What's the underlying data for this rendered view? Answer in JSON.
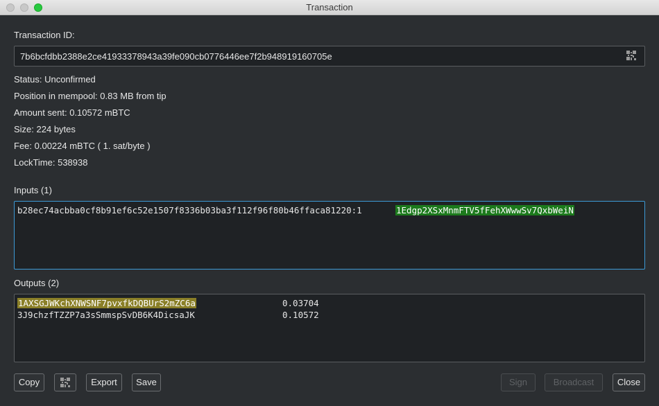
{
  "window": {
    "title": "Transaction"
  },
  "transaction_id": {
    "label": "Transaction ID:",
    "value": "7b6bcfdbb2388e2ce41933378943a39fe090cb0776446ee7f2b948919160705e"
  },
  "details": {
    "status": "Status: Unconfirmed",
    "mempool": "Position in mempool: 0.83 MB from tip",
    "amount": "Amount sent: 0.10572 mBTC",
    "size": "Size: 224 bytes",
    "fee": "Fee: 0.00224 mBTC  ( 1. sat/byte )",
    "locktime": "LockTime: 538938"
  },
  "inputs": {
    "label": "Inputs (1)",
    "items": [
      {
        "outpoint": "b28ec74acbba0cf8b91ef6c52e1507f8336b03ba3f112f96f80b46ffaca81220:1",
        "address": "1Edgp2XSxMnmFTV5fFehXWwwSv7QxbWeiN"
      }
    ]
  },
  "outputs": {
    "label": "Outputs (2)",
    "items": [
      {
        "address": "1AXSGJWKchXNWSNF7pvxfkDQBUrS2mZC6a",
        "amount": "0.03704"
      },
      {
        "address": "3J9chzfTZZP7a3sSmmspSvDB6K4DicsaJK",
        "amount": "0.10572"
      }
    ]
  },
  "buttons": {
    "copy": "Copy",
    "export": "Export",
    "save": "Save",
    "sign": "Sign",
    "broadcast": "Broadcast",
    "close": "Close"
  },
  "colors": {
    "background": "#2b2e31",
    "field": "#1f2225",
    "focus_border": "#3d9bd6",
    "input_highlight": "#1c7a1c",
    "change_highlight": "#8a7f27"
  }
}
